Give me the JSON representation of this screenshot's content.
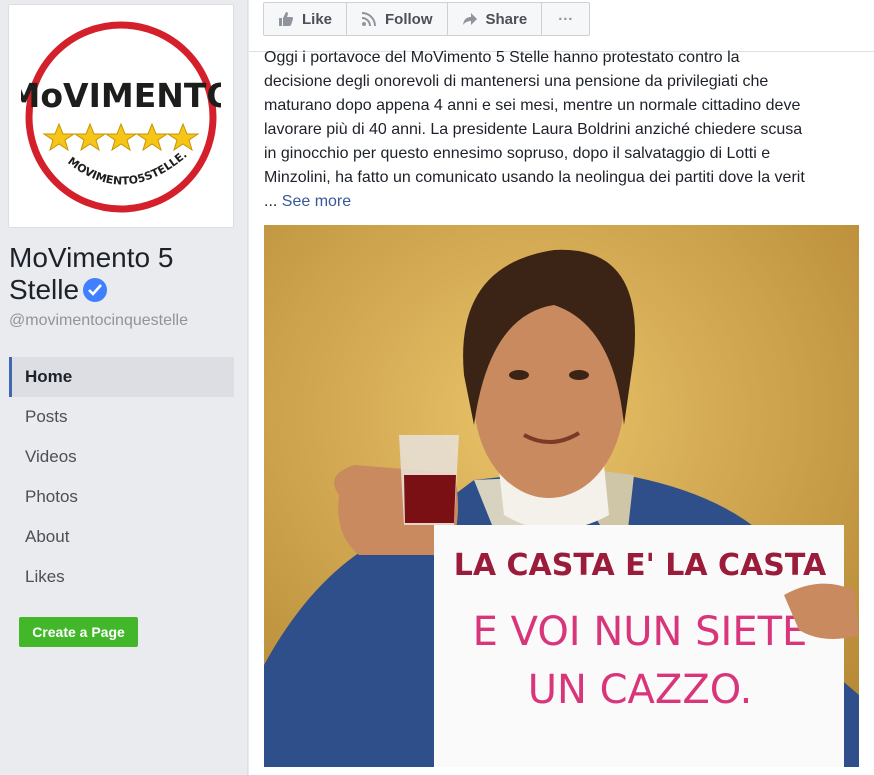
{
  "sidebar": {
    "profile": {
      "logo_text": "MoVIMENTO",
      "logo_url": "MOVIMENTO5STELLE.IT",
      "star_color": "#f5c518",
      "ring_color": "#d3202a"
    },
    "page_name": "MoVimento 5 Stelle",
    "handle": "@movimentocinquestelle",
    "nav": [
      {
        "label": "Home",
        "active": true
      },
      {
        "label": "Posts"
      },
      {
        "label": "Videos"
      },
      {
        "label": "Photos"
      },
      {
        "label": "About"
      },
      {
        "label": "Likes"
      }
    ],
    "create_page_label": "Create a Page"
  },
  "topbar": {
    "like_label": "Like",
    "follow_label": "Follow",
    "share_label": "Share",
    "more_label": "···"
  },
  "post": {
    "lines": [
      "Oggi i portavoce del MoVimento 5 Stelle hanno protestato contro la",
      "decisione degli onorevoli di mantenersi una pensione da privilegiati che",
      "maturano dopo appena 4 anni e sei mesi, mentre un normale cittadino deve",
      "lavorare più di 40 anni. La presidente Laura Boldrini anziché chiedere scusa",
      "in ginocchio per questo ennesimo sopruso, dopo il salvataggio di Lotti e",
      "Minzolini, ha fatto un comunicato usando la neolingua dei partiti dove la verit"
    ],
    "ellipsis": "... ",
    "see_more": "See more",
    "image": {
      "sign_line1": "LA CASTA E' LA CASTA",
      "sign_line2": "E VOI NUN SIETE",
      "sign_line3": "UN CAZZO."
    }
  }
}
